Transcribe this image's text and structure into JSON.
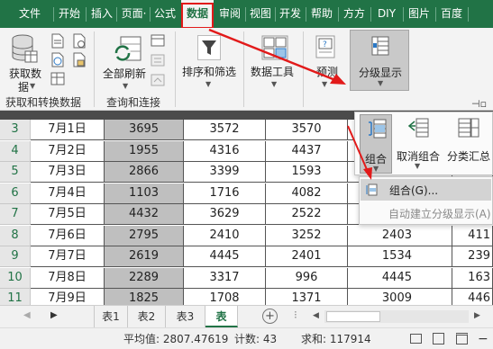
{
  "ribbon_tabs": [
    "文件",
    "开始",
    "插入",
    "页面·",
    "公式",
    "数据",
    "审阅",
    "视图",
    "开发",
    "帮助",
    "方方",
    "DIY",
    "图片",
    "百度"
  ],
  "active_tab": "数据",
  "ribbon": {
    "get_data_line1": "获取数",
    "get_data_line2": "据",
    "get_transform_group": "获取和转换数据",
    "refresh_all": "全部刷新",
    "queries_group": "查询和连接",
    "sort_filter": "排序和筛选",
    "data_tools": "数据工具",
    "forecast": "预测",
    "outline": "分级显示"
  },
  "outline_panel": {
    "group": "组合",
    "ungroup": "取消组合",
    "subtotal": "分类汇总"
  },
  "group_menu": {
    "group_item": "组合(G)...",
    "auto_outline": "自动建立分级显示(A)"
  },
  "rows": [
    {
      "num": "3",
      "date": "7月1日",
      "b": "3695",
      "c": "3572",
      "d": "3570",
      "e": "",
      "f": ""
    },
    {
      "num": "4",
      "date": "7月2日",
      "b": "1955",
      "c": "4316",
      "d": "4437",
      "e": "",
      "f": ""
    },
    {
      "num": "5",
      "date": "7月3日",
      "b": "2866",
      "c": "3399",
      "d": "1593",
      "e": "",
      "f": ""
    },
    {
      "num": "6",
      "date": "7月4日",
      "b": "1103",
      "c": "1716",
      "d": "4082",
      "e": "",
      "f": ""
    },
    {
      "num": "7",
      "date": "7月5日",
      "b": "4432",
      "c": "3629",
      "d": "2522",
      "e": "",
      "f": ""
    },
    {
      "num": "8",
      "date": "7月6日",
      "b": "2795",
      "c": "2410",
      "d": "3252",
      "e": "2403",
      "f": "411"
    },
    {
      "num": "9",
      "date": "7月7日",
      "b": "2619",
      "c": "4445",
      "d": "2401",
      "e": "1534",
      "f": "239"
    },
    {
      "num": "10",
      "date": "7月8日",
      "b": "2289",
      "c": "3317",
      "d": "996",
      "e": "4445",
      "f": "163"
    },
    {
      "num": "11",
      "date": "7月9日",
      "b": "1825",
      "c": "1708",
      "d": "1371",
      "e": "3009",
      "f": "446"
    }
  ],
  "sheets": [
    "表1",
    "表2",
    "表3",
    "表"
  ],
  "status": {
    "average": "平均值: 2807.47619",
    "count": "计数: 43",
    "sum": "求和: 117914"
  }
}
